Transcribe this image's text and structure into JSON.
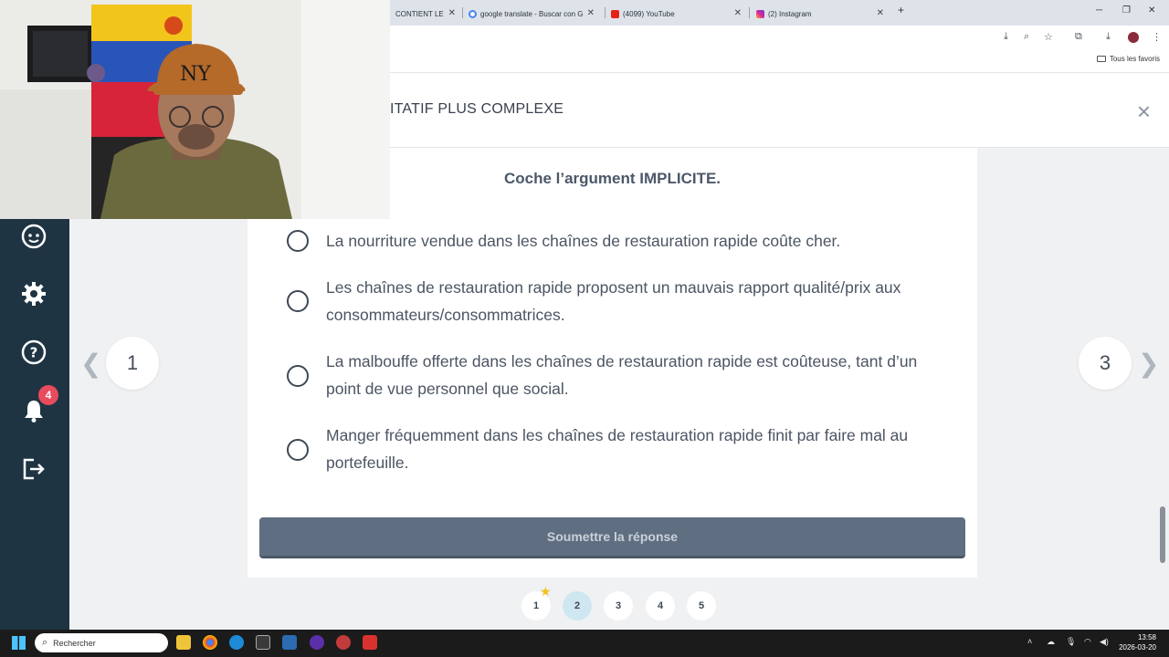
{
  "browser": {
    "tabs": [
      {
        "label": "CONTIENT LE"
      },
      {
        "label": "google translate - Buscar con G"
      },
      {
        "label": "(4099) YouTube"
      },
      {
        "label": "(2) Instagram"
      }
    ],
    "new_tab": "+",
    "bookmarks_folder": "Tous les favoris"
  },
  "header": {
    "title": "ITATIF PLUS COMPLEXE",
    "close": "×"
  },
  "sidebar": {
    "notification_count": "4"
  },
  "quiz": {
    "question": "Coche l’argument IMPLICITE.",
    "options": [
      {
        "text": "La nourriture vendue dans les chaînes de restauration rapide coûte cher."
      },
      {
        "text": "Les chaînes de restauration rapide proposent un mauvais rapport qualité/prix aux consommateurs/consommatrices."
      },
      {
        "text": "La malbouffe offerte dans les chaînes de restauration rapide est coûteuse, tant d’un point de vue personnel que social."
      },
      {
        "text": "Manger fréquemment dans les chaînes de restauration rapide finit par faire mal au portefeuille."
      }
    ],
    "submit_label": "Soumettre la réponse"
  },
  "nav": {
    "prev_arrow": "❮",
    "prev_number": "1",
    "next_number": "3",
    "next_arrow": "❯"
  },
  "pagination": {
    "pages": [
      "1",
      "2",
      "3",
      "4",
      "5"
    ],
    "active": "2",
    "starred": "1"
  },
  "taskbar": {
    "search_placeholder": "Rechercher",
    "time": "13:58",
    "date": "2026-03-20"
  },
  "colors": {
    "sidebar": "#1f3442",
    "submit": "#5f6e80",
    "active_page": "#cfe7f1",
    "badge": "#e74b5c"
  }
}
